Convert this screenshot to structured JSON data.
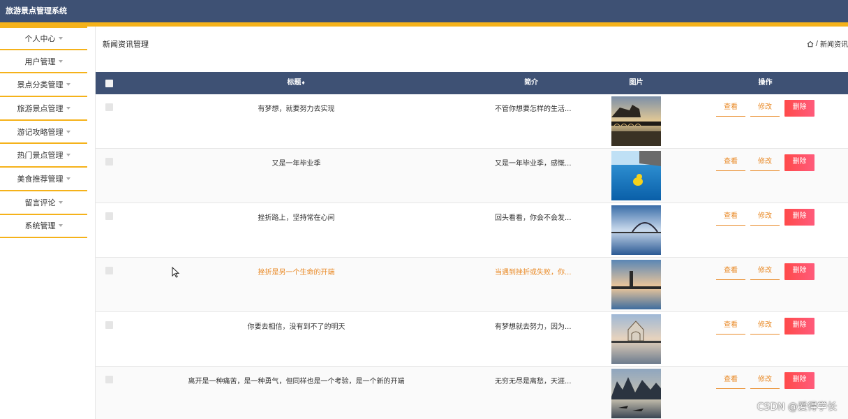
{
  "app": {
    "title": "旅游景点管理系统"
  },
  "sidebar": {
    "items": [
      {
        "label": "个人中心"
      },
      {
        "label": "用户管理"
      },
      {
        "label": "景点分类管理"
      },
      {
        "label": "旅游景点管理"
      },
      {
        "label": "游记攻略管理"
      },
      {
        "label": "热门景点管理"
      },
      {
        "label": "美食推荐管理"
      },
      {
        "label": "留言评论"
      },
      {
        "label": "系统管理"
      }
    ]
  },
  "page": {
    "title": "新闻资讯管理",
    "breadcrumb_sep": "/",
    "breadcrumb_current": "新闻资讯"
  },
  "table": {
    "columns": {
      "title": "标题",
      "intro": "简介",
      "image": "图片",
      "actions": "操作"
    },
    "sort_indicator": "♦",
    "rows": [
      {
        "title": "有梦想，就要努力去实现",
        "intro": "不管你想要怎样的生活...",
        "image": "bridge-pavilion-sunset"
      },
      {
        "title": "又是一年毕业季",
        "intro": "又是一年毕业季，感慨...",
        "image": "rubber-duck-pool"
      },
      {
        "title": "挫折路上，坚持常在心间",
        "intro": "回头看看，你会不会发...",
        "image": "bridge-over-water"
      },
      {
        "title": "挫折是另一个生命的开端",
        "intro": "当遇到挫折或失败，你...",
        "image": "tower-lake-sunset"
      },
      {
        "title": "你要去相信，没有到不了的明天",
        "intro": "有梦想就去努力，因为...",
        "image": "temple-reflection"
      },
      {
        "title": "离开是一种痛苦，是一种勇气，但同样也是一个考验，是一个新的开端",
        "intro": "无穷无尽是离愁，天涯...",
        "image": "karst-mountains-boats"
      }
    ],
    "actions": {
      "view": "查看",
      "edit": "修改",
      "delete": "删除"
    }
  },
  "watermark": "CSDN @爱得学长",
  "colors": {
    "header": "#3e5174",
    "accent": "#f5b21a",
    "action": "#e98a27",
    "delete": "#ff4a4a"
  }
}
